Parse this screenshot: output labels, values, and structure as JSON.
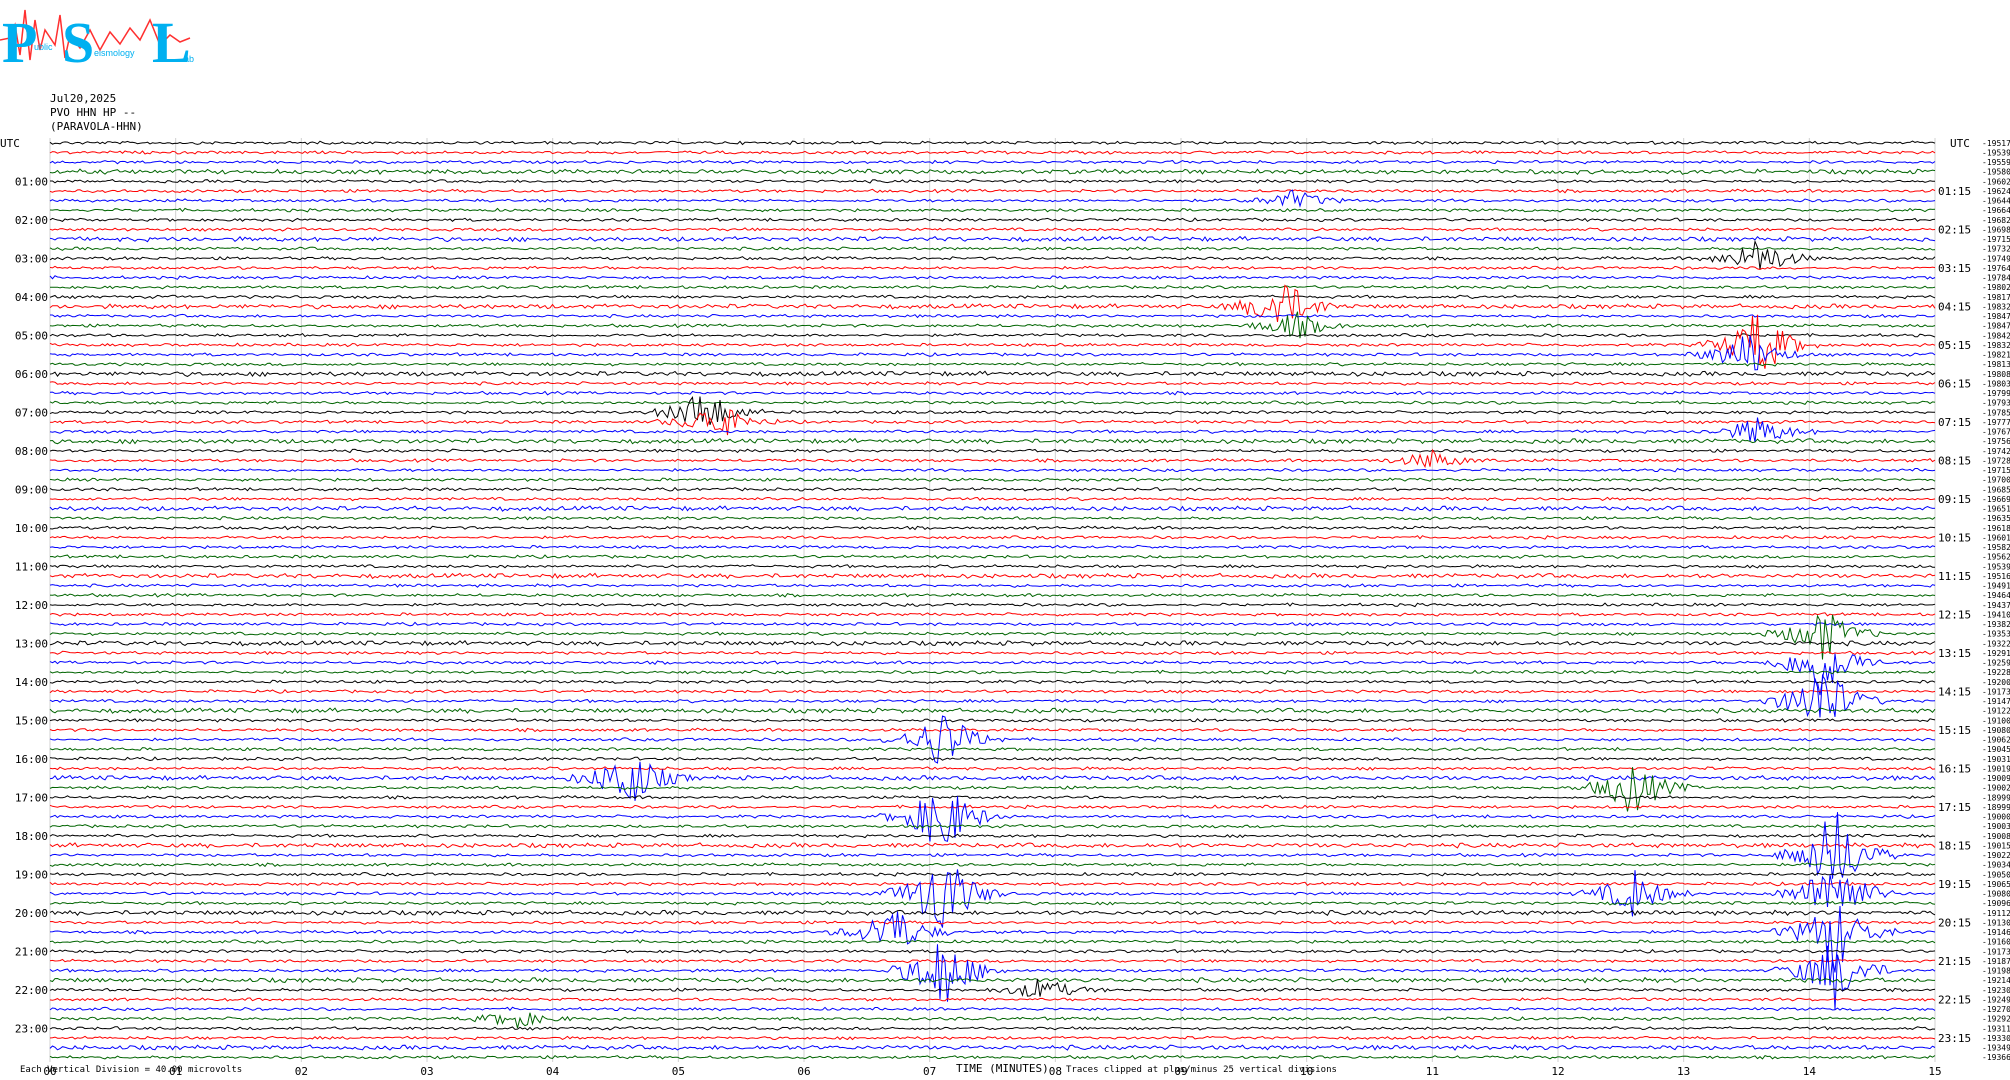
{
  "header": {
    "logo_letters": [
      "P",
      "S",
      "L"
    ],
    "logo_words": [
      "ublic",
      "eismology",
      "ab"
    ],
    "date": "Jul20,2025",
    "channel": "PVO HHN HP --",
    "station": "(PARAVOLA-HHN)"
  },
  "colors": {
    "traces": [
      "#000000",
      "#ff0000",
      "#0000ff",
      "#006400"
    ],
    "logo": "#00b0f0",
    "logo_wave": "#ff3030"
  },
  "chart_data": {
    "type": "line",
    "title": "",
    "xlabel": "TIME (MINUTES)",
    "ylabel": "UTC",
    "right_ylabel": "UTC",
    "xlim": [
      0,
      15
    ],
    "x_ticks": [
      "00",
      "01",
      "02",
      "03",
      "04",
      "05",
      "06",
      "07",
      "08",
      "09",
      "10",
      "11",
      "12",
      "13",
      "14",
      "15"
    ],
    "left_hour_labels": [
      "01:00",
      "02:00",
      "03:00",
      "04:00",
      "05:00",
      "06:00",
      "07:00",
      "08:00",
      "09:00",
      "10:00",
      "11:00",
      "12:00",
      "13:00",
      "14:00",
      "15:00",
      "16:00",
      "17:00",
      "18:00",
      "19:00",
      "20:00",
      "21:00",
      "22:00",
      "23:00"
    ],
    "right_hour_labels": [
      "01:15",
      "02:15",
      "03:15",
      "04:15",
      "05:15",
      "06:15",
      "07:15",
      "08:15",
      "09:15",
      "10:15",
      "11:15",
      "12:15",
      "13:15",
      "14:15",
      "15:15",
      "16:15",
      "17:15",
      "18:15",
      "19:15",
      "20:15",
      "21:15",
      "22:15",
      "23:15"
    ],
    "trace_count": 96,
    "minutes_per_trace": 15,
    "trace_offsets": [
      "-19517",
      "-19539",
      "-19559",
      "-19580",
      "-19602",
      "-19624",
      "-19644",
      "-19664",
      "-19682",
      "-19698",
      "-19715",
      "-19732",
      "-19749",
      "-19764",
      "-19784",
      "-19802",
      "-19817",
      "-19832",
      "-19847",
      "-19847",
      "-19842",
      "-19832",
      "-19821",
      "-19813",
      "-19808",
      "-19803",
      "-19799",
      "-19793",
      "-19785",
      "-19777",
      "-19767",
      "-19756",
      "-19742",
      "-19728",
      "-19715",
      "-19700",
      "-19685",
      "-19669",
      "-19651",
      "-19635",
      "-19618",
      "-19601",
      "-19582",
      "-19562",
      "-19539",
      "-19516",
      "-19491",
      "-19464",
      "-19437",
      "-19410",
      "-19382",
      "-19353",
      "-19322",
      "-19291",
      "-19259",
      "-19228",
      "-19200",
      "-19173",
      "-19147",
      "-19122",
      "-19100",
      "-19080",
      "-19062",
      "-19045",
      "-19031",
      "-19019",
      "-19009",
      "-19002",
      "-18999",
      "-18999",
      "-19000",
      "-19003",
      "-19008",
      "-19015",
      "-19022",
      "-19034",
      "-19050",
      "-19065",
      "-19080",
      "-19096",
      "-19112",
      "-19130",
      "-19146",
      "-19160",
      "-19173",
      "-19187",
      "-19198",
      "-19214",
      "-19230",
      "-19249",
      "-19270",
      "-19292",
      "-19311",
      "-19330",
      "-19349",
      "-19366"
    ],
    "events": [
      {
        "trace": 6,
        "minute": 9.9,
        "amp": 1.2
      },
      {
        "trace": 12,
        "minute": 13.6,
        "amp": 2.5
      },
      {
        "trace": 17,
        "minute": 9.8,
        "amp": 3.5
      },
      {
        "trace": 19,
        "minute": 9.9,
        "amp": 1.8
      },
      {
        "trace": 21,
        "minute": 13.6,
        "amp": 4.5
      },
      {
        "trace": 22,
        "minute": 13.5,
        "amp": 3.0
      },
      {
        "trace": 28,
        "minute": 5.2,
        "amp": 3.0
      },
      {
        "trace": 29,
        "minute": 5.3,
        "amp": 2.5
      },
      {
        "trace": 30,
        "minute": 13.6,
        "amp": 2.0
      },
      {
        "trace": 33,
        "minute": 11.0,
        "amp": 1.2
      },
      {
        "trace": 51,
        "minute": 14.1,
        "amp": 3.5
      },
      {
        "trace": 54,
        "minute": 14.1,
        "amp": 4.5
      },
      {
        "trace": 58,
        "minute": 14.1,
        "amp": 5.0
      },
      {
        "trace": 62,
        "minute": 7.1,
        "amp": 4.0
      },
      {
        "trace": 66,
        "minute": 4.6,
        "amp": 4.0
      },
      {
        "trace": 67,
        "minute": 12.6,
        "amp": 3.5
      },
      {
        "trace": 70,
        "minute": 7.1,
        "amp": 5.0
      },
      {
        "trace": 74,
        "minute": 14.2,
        "amp": 6.0
      },
      {
        "trace": 78,
        "minute": 7.1,
        "amp": 6.0
      },
      {
        "trace": 78,
        "minute": 12.6,
        "amp": 3.0
      },
      {
        "trace": 78,
        "minute": 14.2,
        "amp": 5.0
      },
      {
        "trace": 82,
        "minute": 6.7,
        "amp": 3.5
      },
      {
        "trace": 82,
        "minute": 14.2,
        "amp": 5.0
      },
      {
        "trace": 86,
        "minute": 7.1,
        "amp": 5.0
      },
      {
        "trace": 86,
        "minute": 14.2,
        "amp": 4.5
      },
      {
        "trace": 88,
        "minute": 7.9,
        "amp": 1.5
      },
      {
        "trace": 91,
        "minute": 3.7,
        "amp": 1.2
      }
    ],
    "footer_left": "Each Vertical Division =   40.00 microvolts",
    "footer_right": "Traces clipped at plus/minus 25 vertical divisions"
  }
}
